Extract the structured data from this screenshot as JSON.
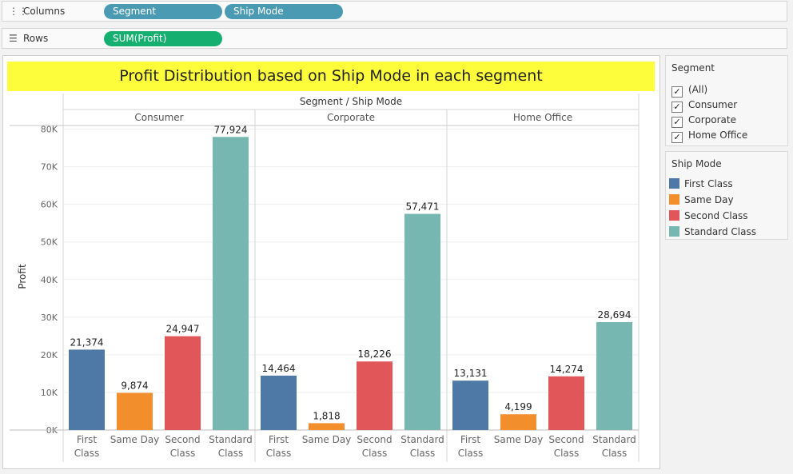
{
  "shelves": {
    "columns_label": "Columns",
    "rows_label": "Rows",
    "columns_pills": [
      "Segment",
      "Ship Mode"
    ],
    "rows_pills": [
      "SUM(Profit)"
    ]
  },
  "colors": {
    "First Class": "#4e79a7",
    "Same Day": "#f28e2b",
    "Second Class": "#e15759",
    "Standard Class": "#76b7b2",
    "title_band": "#fdfd3c",
    "dimension_pill": "#4b9ab3",
    "measure_pill": "#15b070"
  },
  "segment_filter": {
    "title": "Segment",
    "options": [
      {
        "label": "(All)",
        "checked": true
      },
      {
        "label": "Consumer",
        "checked": true
      },
      {
        "label": "Corporate",
        "checked": true
      },
      {
        "label": "Home Office",
        "checked": true
      }
    ]
  },
  "ship_mode_legend": {
    "title": "Ship Mode",
    "items": [
      "First Class",
      "Same Day",
      "Second Class",
      "Standard Class"
    ]
  },
  "chart_data": {
    "type": "bar",
    "title": "Profit Distribution based on Ship Mode in each segment",
    "header_title": "Segment / Ship Mode",
    "ylabel": "Profit",
    "ylim": [
      0,
      85000
    ],
    "yticks": [
      0,
      10000,
      20000,
      30000,
      40000,
      50000,
      60000,
      70000,
      80000
    ],
    "ytick_labels": [
      "0K",
      "10K",
      "20K",
      "30K",
      "40K",
      "50K",
      "60K",
      "70K",
      "80K"
    ],
    "grid": true,
    "legend": "right",
    "categories": [
      "First Class",
      "Same Day",
      "Second Class",
      "Standard Class"
    ],
    "category_labels": [
      [
        "First",
        "Class"
      ],
      [
        "Same Day"
      ],
      [
        "Second",
        "Class"
      ],
      [
        "Standard",
        "Class"
      ]
    ],
    "panels": [
      {
        "name": "Consumer",
        "values": [
          21374,
          9874,
          24947,
          77924
        ],
        "labels": [
          "21,374",
          "9,874",
          "24,947",
          "77,924"
        ]
      },
      {
        "name": "Corporate",
        "values": [
          14464,
          1818,
          18226,
          57471
        ],
        "labels": [
          "14,464",
          "1,818",
          "18,226",
          "57,471"
        ]
      },
      {
        "name": "Home Office",
        "values": [
          13131,
          4199,
          14274,
          28694
        ],
        "labels": [
          "13,131",
          "4,199",
          "14,274",
          "28,694"
        ]
      }
    ]
  }
}
